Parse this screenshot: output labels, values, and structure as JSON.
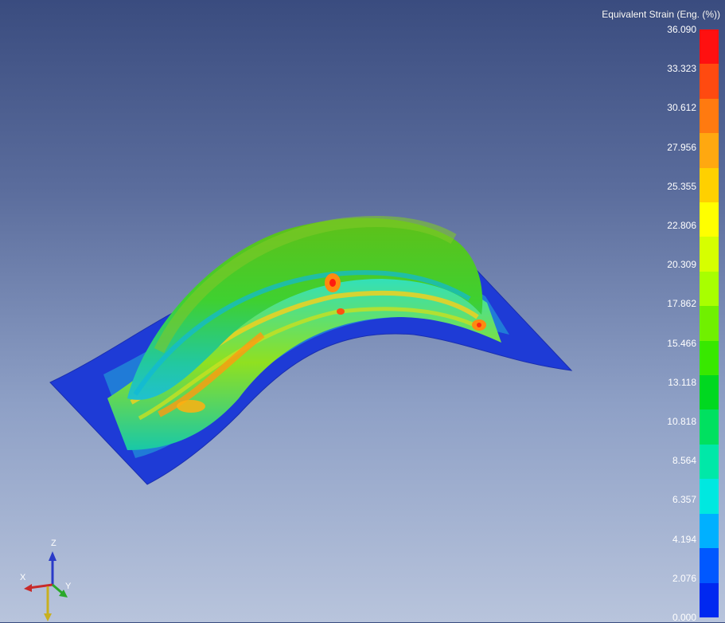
{
  "legend": {
    "title": "Equivalent Strain (Eng. (%))",
    "ticks": [
      "36.090",
      "33.323",
      "30.612",
      "27.956",
      "25.355",
      "22.806",
      "20.309",
      "17.862",
      "15.466",
      "13.118",
      "10.818",
      "8.564",
      "6.357",
      "4.194",
      "2.076",
      "0.000"
    ],
    "colors": [
      "#ff1010",
      "#ff4a10",
      "#ff7a10",
      "#ffa810",
      "#ffd000",
      "#ffff00",
      "#d6ff00",
      "#a8ff00",
      "#70f000",
      "#38e800",
      "#00d820",
      "#00e060",
      "#00e8a8",
      "#00e8e0",
      "#00b0ff",
      "#0058ff",
      "#0028f0"
    ]
  },
  "triad": {
    "x_label": "X",
    "y_label": "Y",
    "z_label": "Z"
  }
}
